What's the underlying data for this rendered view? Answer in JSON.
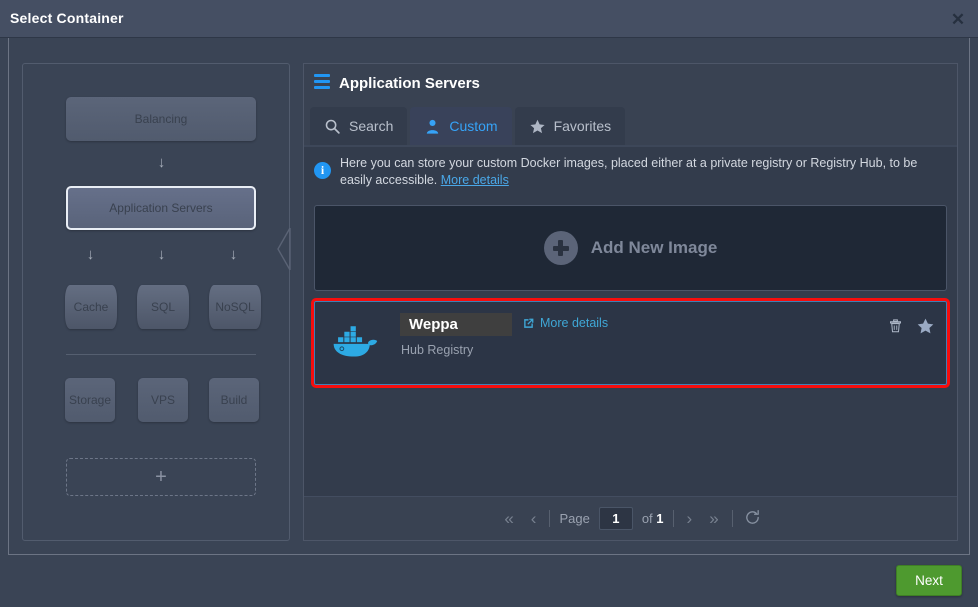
{
  "window": {
    "title": "Select Container",
    "close_icon": "close-icon"
  },
  "topology": {
    "nodes": [
      {
        "label": "Balancing",
        "type": "box",
        "selected": false
      },
      {
        "label": "Application Servers",
        "type": "box",
        "selected": true
      },
      {
        "label": "Cache",
        "type": "cylinder",
        "selected": false
      },
      {
        "label": "SQL",
        "type": "cylinder",
        "selected": false
      },
      {
        "label": "NoSQL",
        "type": "cylinder",
        "selected": false
      },
      {
        "label": "Storage",
        "type": "box",
        "selected": false
      },
      {
        "label": "VPS",
        "type": "box",
        "selected": false
      },
      {
        "label": "Build",
        "type": "box",
        "selected": false
      }
    ],
    "add_label": "+",
    "arrow_glyph": "↓"
  },
  "panel": {
    "menu_icon": "hamburger-icon",
    "title": "Application Servers",
    "tabs": [
      {
        "label": "Search",
        "icon": "search-icon",
        "active": false
      },
      {
        "label": "Custom",
        "icon": "user-icon",
        "active": true
      },
      {
        "label": "Favorites",
        "icon": "star-icon",
        "active": false
      }
    ],
    "info": {
      "icon": "info-icon",
      "text": "Here you can store your custom Docker images, placed either at a private registry or Registry Hub, to be easily accessible.",
      "link_label": "More details"
    },
    "add_new_image": {
      "label": "Add New Image",
      "icon": "plus-circle-icon"
    },
    "images": [
      {
        "icon": "docker-whale-icon",
        "name": "Weppa",
        "registry": "Hub Registry",
        "more_details_label": "More details",
        "more_details_icon": "external-link-icon",
        "delete_icon": "trash-icon",
        "favorite_icon": "star-icon",
        "highlighted": true
      }
    ],
    "pagination": {
      "first_icon": "«",
      "prev_icon": "‹",
      "page_label": "Page",
      "page_value": "1",
      "of_label": "of",
      "total_pages": "1",
      "next_icon": "›",
      "last_icon": "»",
      "refresh_icon": "refresh-icon"
    }
  },
  "footer": {
    "next_label": "Next"
  },
  "colors": {
    "accent_blue": "#2196f3",
    "link_blue": "#4aa8e8",
    "docker_blue": "#2496ed",
    "highlight_red": "#f60d0d",
    "next_green": "#4e9a2f",
    "panel_bg": "#333c4c",
    "dialog_bg": "#3a4455"
  }
}
